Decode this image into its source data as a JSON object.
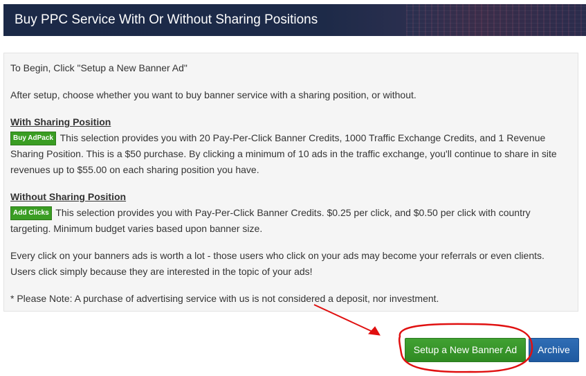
{
  "header": {
    "title": "Buy PPC Service With Or Without Sharing Positions"
  },
  "intro": {
    "begin": "To Begin, Click \"Setup a New Banner Ad\"",
    "after_setup": "After setup, choose whether you want to buy banner service with a sharing position, or without."
  },
  "with_sharing": {
    "title": "With Sharing Position",
    "badge": "Buy AdPack",
    "text": "This selection provides you with 20 Pay-Per-Click Banner Credits, 1000 Traffic Exchange Credits, and 1 Revenue Sharing Position. This is a $50 purchase. By clicking a minimum of 10 ads in the traffic exchange, you'll continue to share in site revenues up to $55.00 on each sharing position you have."
  },
  "without_sharing": {
    "title": "Without Sharing Position",
    "badge": "Add Clicks",
    "text": "This selection provides you with Pay-Per-Click Banner Credits. $0.25 per click, and $0.50 per click with country targeting. Minimum budget varies based upon banner size."
  },
  "note_clicks": "Every click on your banners ads is worth a lot - those users who click on your ads may become your referrals or even clients. Users click simply because they are interested in the topic of your ads!",
  "note_deposit": "* Please Note: A purchase of advertising service with us is not considered a deposit, nor investment.",
  "buttons": {
    "setup": "Setup a New Banner Ad",
    "archive": "Archive"
  },
  "colors": {
    "header_bg": "#1b2947",
    "badge_green": "#3a9d23",
    "setup_green": "#2f8a22",
    "archive_blue": "#1f5aa0",
    "annotation_red": "#e01010"
  }
}
